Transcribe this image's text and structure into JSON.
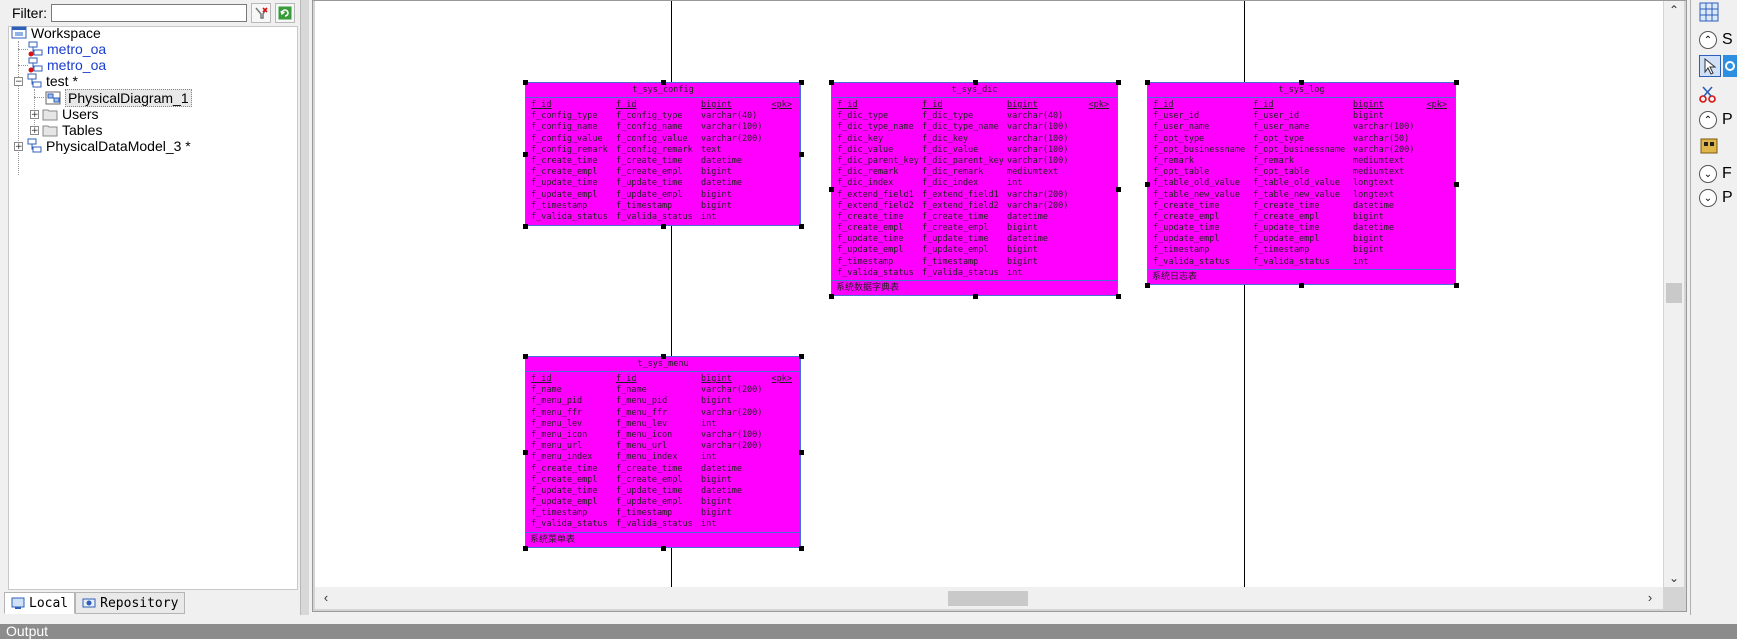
{
  "filter": {
    "label": "Filter:",
    "value": "",
    "placeholder": ""
  },
  "tree": {
    "items": [
      {
        "label": "Workspace"
      },
      {
        "label": "metro_oa"
      },
      {
        "label": "metro_oa"
      },
      {
        "label": "test *"
      },
      {
        "label": "PhysicalDiagram_1"
      },
      {
        "label": "Users"
      },
      {
        "label": "Tables"
      },
      {
        "label": "PhysicalDataModel_3 *"
      }
    ],
    "expanders": {
      "plus": "+",
      "minus": "−"
    }
  },
  "tabs": [
    {
      "label": "Local"
    },
    {
      "label": "Repository"
    }
  ],
  "palette": {
    "letters": [
      "S",
      "P",
      "F",
      "P"
    ]
  },
  "output": {
    "label": "Output"
  },
  "entities": [
    {
      "title": "t_sys_config",
      "header": [
        "f_id",
        "f_id",
        "bigint",
        "<pk>"
      ],
      "rows": [
        [
          "f_config_type",
          "f_config_type",
          "varchar(40)"
        ],
        [
          "f_config_name",
          "f_config_name",
          "varchar(100)"
        ],
        [
          "f_config_value",
          "f_config_value",
          "varchar(200)"
        ],
        [
          "f_config_remark",
          "f_config_remark",
          "text"
        ],
        [
          "f_create_time",
          "f_create_time",
          "datetime"
        ],
        [
          "f_create_empl",
          "f_create_empl",
          "bigint"
        ],
        [
          "f_update_time",
          "f_update_time",
          "datetime"
        ],
        [
          "f_update_empl",
          "f_update_empl",
          "bigint"
        ],
        [
          "f_timestamp",
          "f_timestamp",
          "bigint"
        ],
        [
          "f_valida_status",
          "f_valida_status",
          "int"
        ]
      ],
      "comment": ""
    },
    {
      "title": "t_sys_dic",
      "header": [
        "f_id",
        "f_id",
        "bigint",
        "<pk>"
      ],
      "rows": [
        [
          "f_dic_type",
          "f_dic_type",
          "varchar(40)"
        ],
        [
          "f_dic_type_name",
          "f_dic_type_name",
          "varchar(100)"
        ],
        [
          "f_dic_key",
          "f_dic_key",
          "varchar(100)"
        ],
        [
          "f_dic_value",
          "f_dic_value",
          "varchar(100)"
        ],
        [
          "f_dic_parent_key",
          "f_dic_parent_key",
          "varchar(100)"
        ],
        [
          "f_dic_remark",
          "f_dic_remark",
          "mediumtext"
        ],
        [
          "f_dic_index",
          "f_dic_index",
          "int"
        ],
        [
          "f_extend_field1",
          "f_extend_field1",
          "varchar(200)"
        ],
        [
          "f_extend_field2",
          "f_extend_field2",
          "varchar(200)"
        ],
        [
          "f_create_time",
          "f_create_time",
          "datetime"
        ],
        [
          "f_create_empl",
          "f_create_empl",
          "bigint"
        ],
        [
          "f_update_time",
          "f_update_time",
          "datetime"
        ],
        [
          "f_update_empl",
          "f_update_empl",
          "bigint"
        ],
        [
          "f_timestamp",
          "f_timestamp",
          "bigint"
        ],
        [
          "f_valida_status",
          "f_valida_status",
          "int"
        ]
      ],
      "comment": "系统数据字典表"
    },
    {
      "title": "t_sys_log",
      "header": [
        "f_id",
        "f_id",
        "bigint",
        "<pk>"
      ],
      "rows": [
        [
          "f_user_id",
          "f_user_id",
          "bigint"
        ],
        [
          "f_user_name",
          "f_user_name",
          "varchar(100)"
        ],
        [
          "f_opt_type",
          "f_opt_type",
          "varchar(50)"
        ],
        [
          "f_opt_businessname",
          "f_opt_businessname",
          "varchar(200)"
        ],
        [
          "f_remark",
          "f_remark",
          "mediumtext"
        ],
        [
          "f_opt_table",
          "f_opt_table",
          "mediumtext"
        ],
        [
          "f_table_old_value",
          "f_table_old_value",
          "longtext"
        ],
        [
          "f_table_new_value",
          "f_table_new_value",
          "longtext"
        ],
        [
          "f_create_time",
          "f_create_time",
          "datetime"
        ],
        [
          "f_create_empl",
          "f_create_empl",
          "bigint"
        ],
        [
          "f_update_time",
          "f_update_time",
          "datetime"
        ],
        [
          "f_update_empl",
          "f_update_empl",
          "bigint"
        ],
        [
          "f_timestamp",
          "f_timestamp",
          "bigint"
        ],
        [
          "f_valida_status",
          "f_valida_status",
          "int"
        ]
      ],
      "comment": "系统日志表"
    },
    {
      "title": "t_sys_menu",
      "header": [
        "f_id",
        "f_id",
        "bigint",
        "<pk>"
      ],
      "rows": [
        [
          "f_name",
          "f_name",
          "varchar(200)"
        ],
        [
          "f_menu_pid",
          "f_menu_pid",
          "bigint"
        ],
        [
          "f_menu_ffr",
          "f_menu_ffr",
          "varchar(200)"
        ],
        [
          "f_menu_lev",
          "f_menu_lev",
          "int"
        ],
        [
          "f_menu_icon",
          "f_menu_icon",
          "varchar(100)"
        ],
        [
          "f_menu_url",
          "f_menu_url",
          "varchar(200)"
        ],
        [
          "f_menu_index",
          "f_menu_index",
          "int"
        ],
        [
          "f_create_time",
          "f_create_time",
          "datetime"
        ],
        [
          "f_create_empl",
          "f_create_empl",
          "bigint"
        ],
        [
          "f_update_time",
          "f_update_time",
          "datetime"
        ],
        [
          "f_update_empl",
          "f_update_empl",
          "bigint"
        ],
        [
          "f_timestamp",
          "f_timestamp",
          "bigint"
        ],
        [
          "f_valida_status",
          "f_valida_status",
          "int"
        ]
      ],
      "comment": "系统菜单表"
    }
  ]
}
